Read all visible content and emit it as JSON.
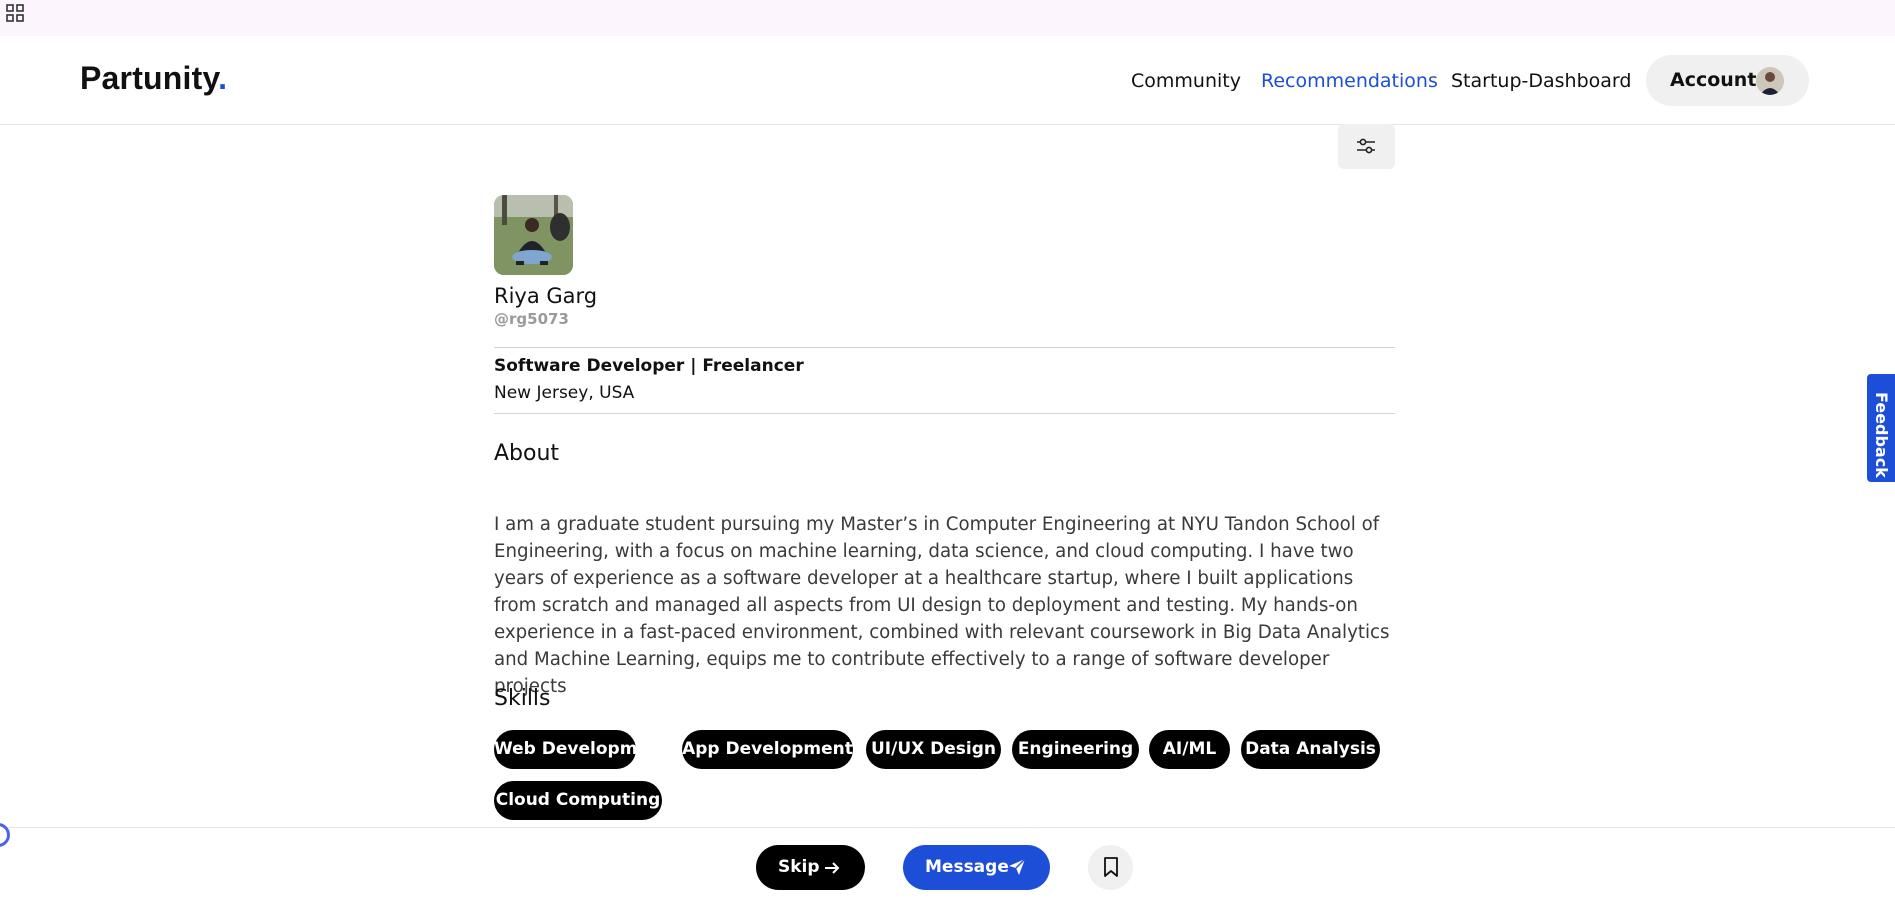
{
  "brand": {
    "name": "Partunity",
    "dot": ".",
    "dot_color": "#1d4ed8"
  },
  "nav": {
    "links": [
      {
        "label": "Community",
        "active": false
      },
      {
        "label": "Recommendations",
        "active": true
      },
      {
        "label": "Startup-Dashboard",
        "active": false
      }
    ],
    "account_label": "Account"
  },
  "feedback": {
    "label": "Feedback"
  },
  "profile": {
    "name": "Riya Garg",
    "handle": "@rg5073",
    "headline": "Software Developer | Freelancer",
    "location": "New Jersey, USA"
  },
  "about": {
    "title": "About",
    "text": "I am a graduate student pursuing my Master’s in Computer Engineering at NYU Tandon School of Engineering, with a focus on machine learning, data science, and cloud computing. I have two years of experience as a software developer at a healthcare startup, where I built applications from scratch and managed all aspects from UI design to deployment and testing. My hands-on experience in a fast-paced environment, combined with relevant coursework in Big Data Analytics and Machine Learning, equips me to contribute effectively to a range of software developer projects"
  },
  "skills": {
    "title": "Skills",
    "items": [
      "Web Development",
      "App Development",
      "UI/UX Design",
      "Engineering",
      "AI/ML",
      "Data Analysis",
      "Cloud Computing"
    ]
  },
  "actions": {
    "skip_label": "Skip",
    "message_label": "Message"
  },
  "icons": {
    "apps": "grid-icon",
    "filter": "sliders-icon",
    "skip": "arrow-right-icon",
    "message": "send-icon",
    "save": "bookmark-icon"
  },
  "colors": {
    "accent": "#1d4ed8",
    "chip_bg": "#000000",
    "topstrip": "#fdf5fd"
  }
}
